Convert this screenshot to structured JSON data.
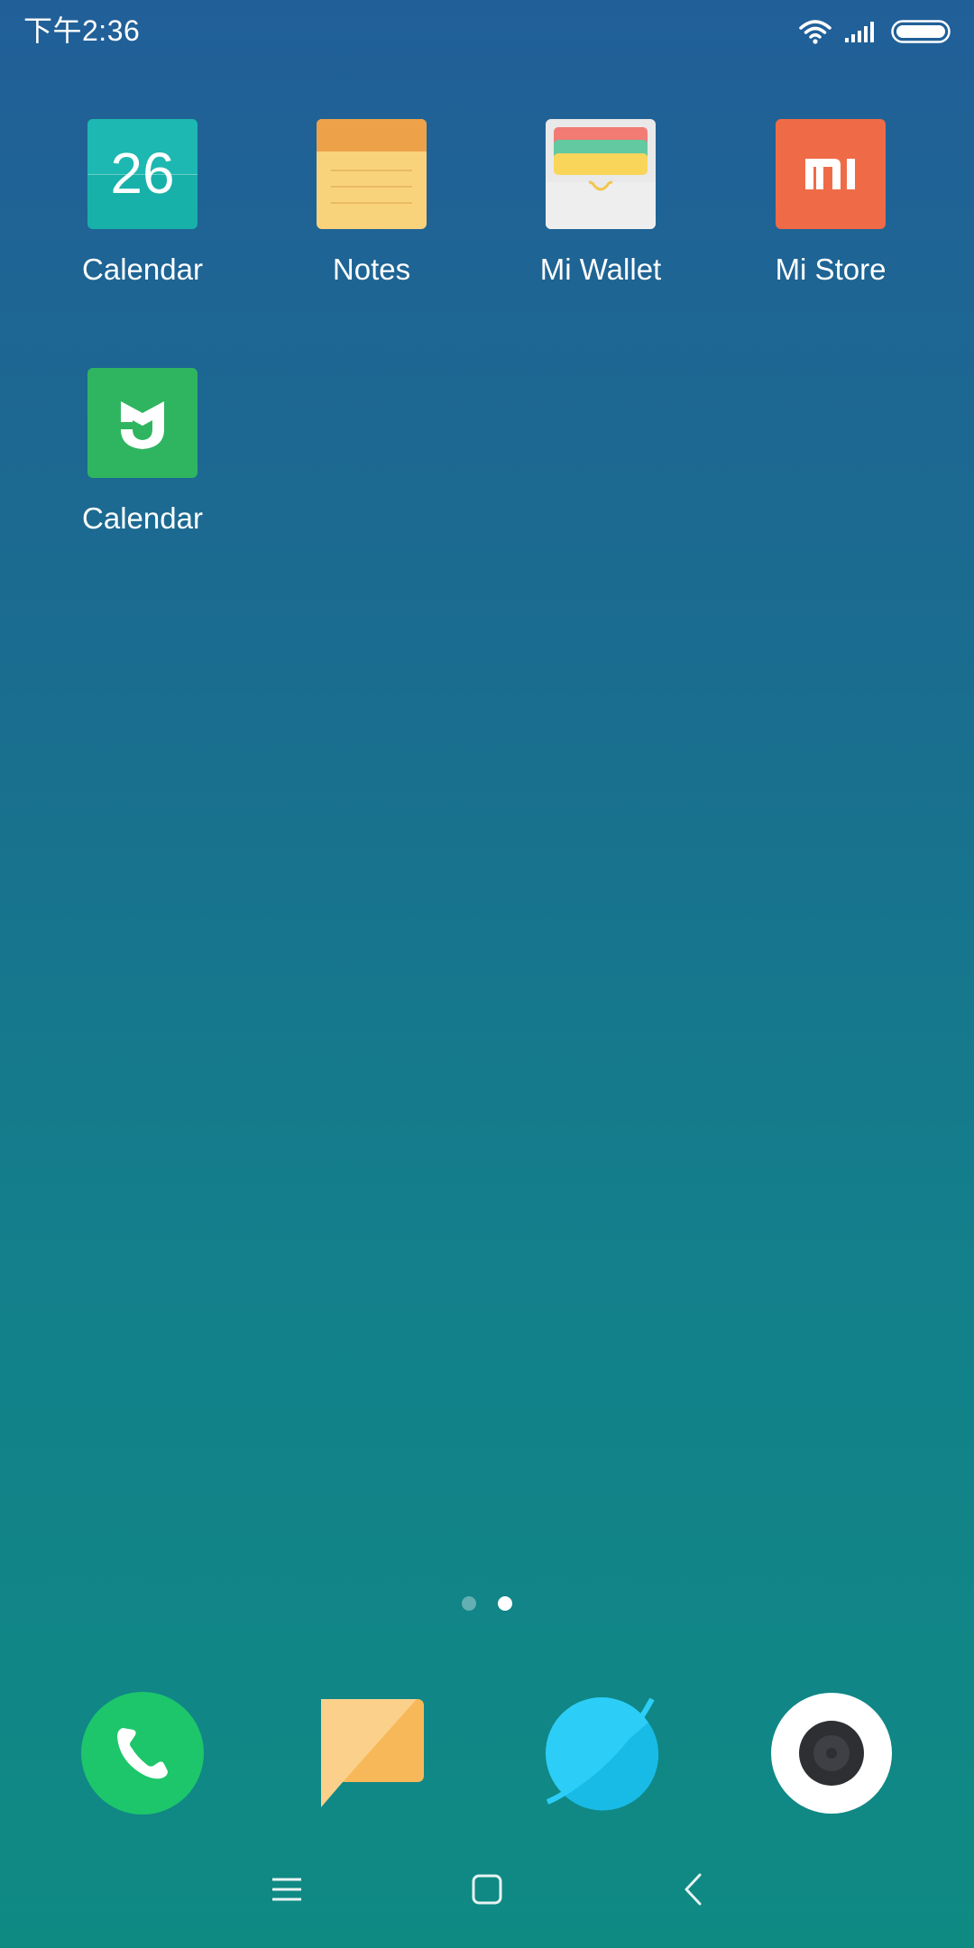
{
  "status_bar": {
    "time": "下午2:36",
    "icons": [
      "wifi-icon",
      "signal-icon",
      "battery-icon"
    ]
  },
  "home": {
    "apps": [
      {
        "label": "Calendar",
        "icon": "calendar-icon",
        "icon_text": "26",
        "color": "#1aaea8"
      },
      {
        "label": "Notes",
        "icon": "notes-icon",
        "color": "#f8d27d"
      },
      {
        "label": "Mi Wallet",
        "icon": "wallet-icon",
        "color": "#eaeaea"
      },
      {
        "label": "Mi Store",
        "icon": "mi-store-icon",
        "color": "#ef6b47"
      },
      {
        "label": "Calendar",
        "icon": "mi-home-icon",
        "color": "#2fb560"
      }
    ],
    "page_indicator": {
      "pages": 2,
      "current": 2
    }
  },
  "dock": [
    {
      "name": "phone-icon",
      "color": "#1dc66b"
    },
    {
      "name": "messaging-icon",
      "color": "#f9bf63"
    },
    {
      "name": "browser-icon",
      "color": "#29c8f3"
    },
    {
      "name": "camera-icon",
      "color": "#ffffff"
    }
  ],
  "nav_bar": [
    "menu-icon",
    "home-icon",
    "back-icon"
  ]
}
